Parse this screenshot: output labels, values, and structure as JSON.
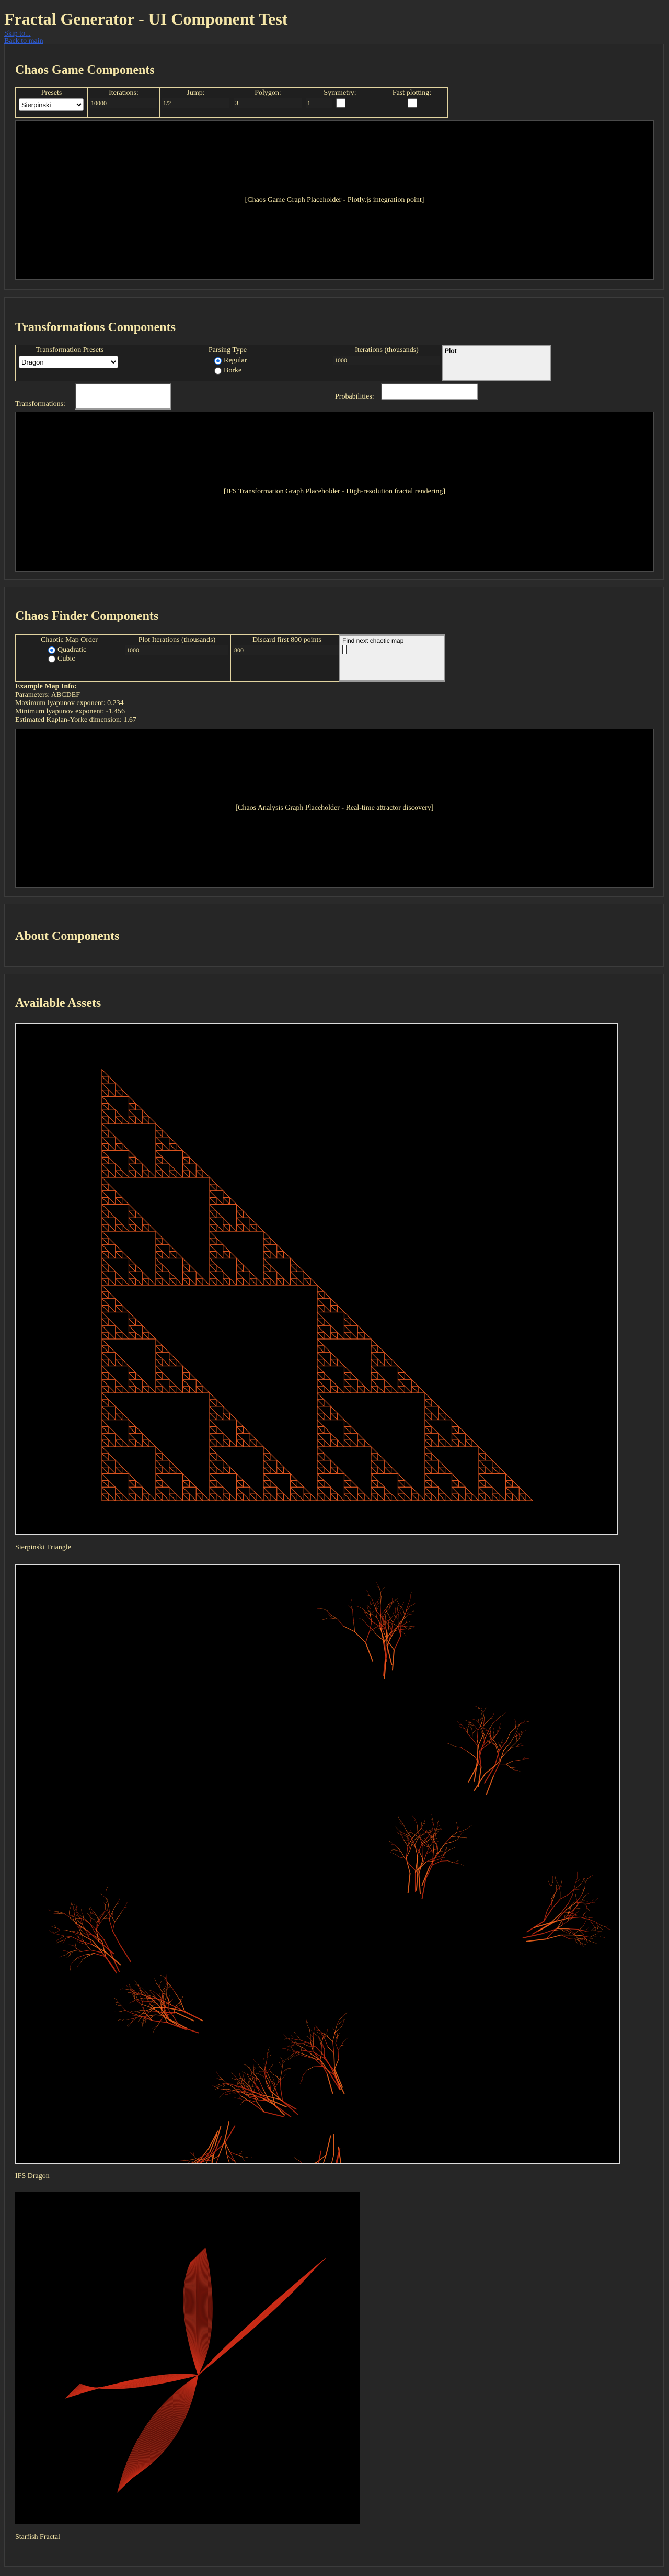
{
  "title": "Fractal Generator - UI Component Test",
  "links": [
    "Skip to...",
    "Back to main"
  ],
  "chaos_game": {
    "heading": "Chaos Game Components",
    "presets_label": "Presets",
    "presets_value": "Sierpinski",
    "iterations_label": "Iterations:",
    "iterations_value": "10000",
    "jump_label": "Jump:",
    "jump_value": "1/2",
    "polygon_label": "Polygon:",
    "polygon_value": "3",
    "symmetry_label": "Symmetry:",
    "symmetry_value": "1",
    "fast_label": "Fast plotting:",
    "graph_text": "[Chaos Game Graph Placeholder - Plotly.js integration point]"
  },
  "transformations": {
    "heading": "Transformations Components",
    "presets_label": "Transformation Presets",
    "presets_value": "Dragon",
    "parsing_label": "Parsing Type",
    "parsing_options": [
      "Regular",
      "Borke"
    ],
    "iterations_label": "Iterations (thousands)",
    "iterations_value": "1000",
    "plot_label": "Plot",
    "transformations_label": "Transformations:",
    "probabilities_label": "Probabilities:",
    "graph_text": "[IFS Transformation Graph Placeholder - High-resolution fractal rendering]"
  },
  "chaos_finder": {
    "heading": "Chaos Finder Components",
    "order_label": "Chaotic Map Order",
    "order_options": [
      "Quadratic",
      "Cubic"
    ],
    "plot_iter_label": "Plot Iterations (thousands)",
    "plot_iter_value": "1000",
    "discard_label": "Discard first 800 points",
    "discard_value": "800",
    "find_label": "Find next chaotic map",
    "info_title": "Example Map Info:",
    "info_lines": [
      "Parameters: ABCDEF",
      "Maximum lyapunov exponent: 0.234",
      "Minimum lyapunov exponent: -1.456",
      "Estimated Kaplan-Yorke dimension: 1.67"
    ],
    "graph_text": "[Chaos Analysis Graph Placeholder - Real-time attractor discovery]"
  },
  "about": {
    "heading": "About Components"
  },
  "assets": {
    "heading": "Available Assets",
    "captions": [
      "Sierpinski Triangle",
      "IFS Dragon",
      "Starfish Fractal"
    ]
  },
  "colors": {
    "accent": "#f5e6a8",
    "background": "#2a2a2a",
    "fractal": "#d9531e"
  }
}
